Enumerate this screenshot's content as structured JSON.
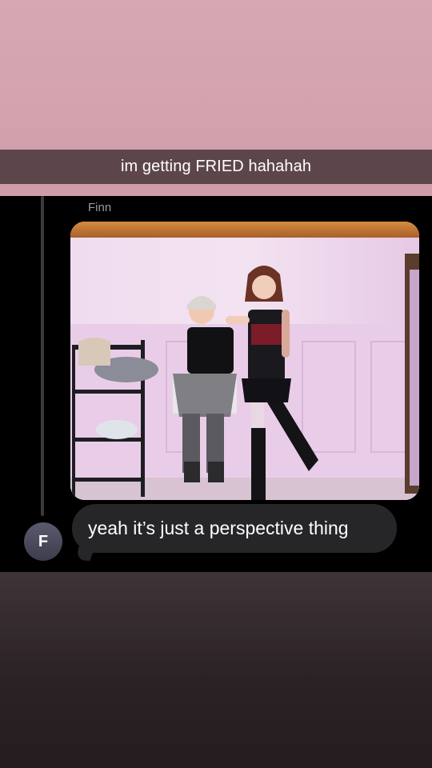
{
  "story": {
    "caption": "im getting FRIED hahahah"
  },
  "chat": {
    "sender_name": "Finn",
    "avatar_initial": "F",
    "message_text": "yeah it’s just a perspective thing"
  },
  "colors": {
    "top_background": "#d6a5b0",
    "caption_bar": "#3c2d30",
    "chat_background": "#000000",
    "bubble": "#262628",
    "bottom_background": "#2b2225"
  }
}
